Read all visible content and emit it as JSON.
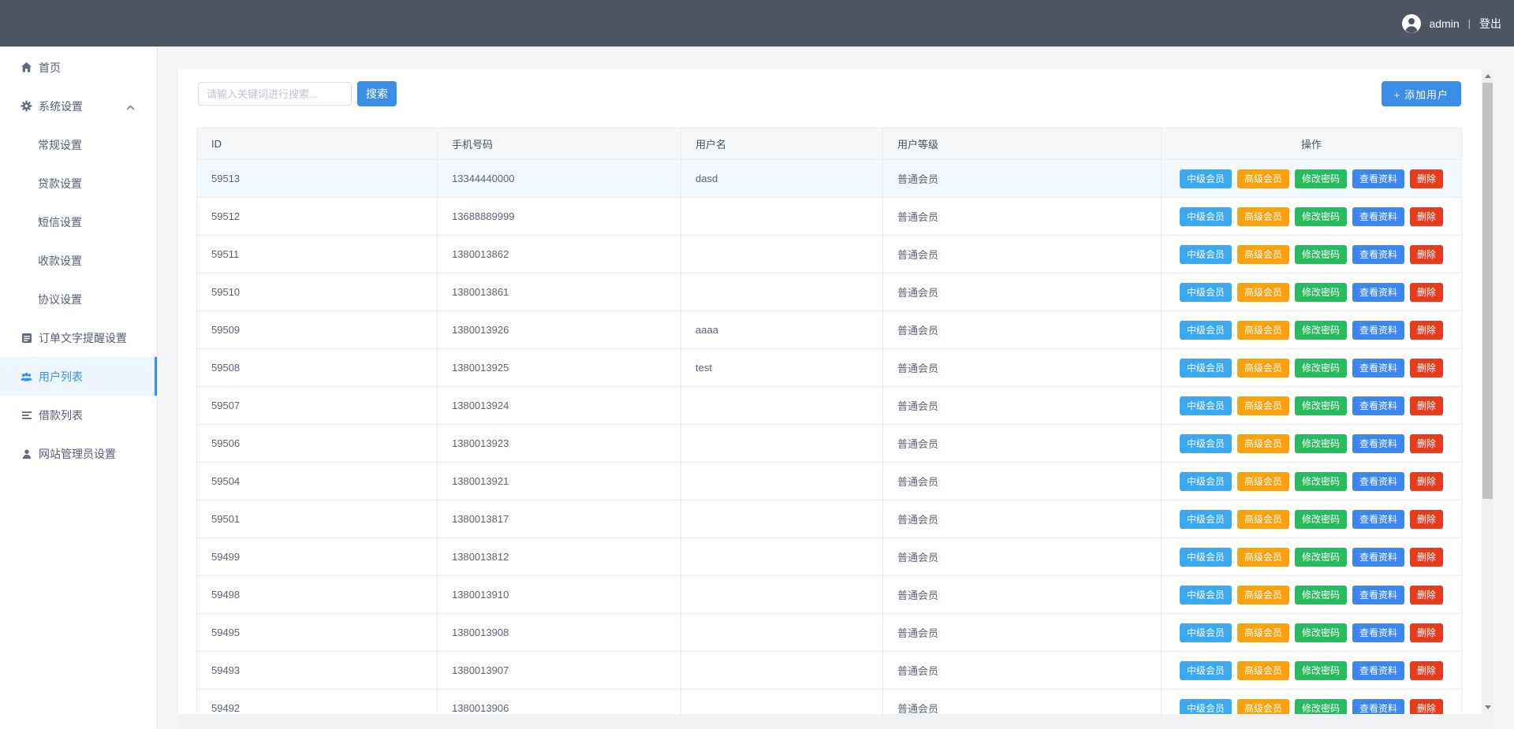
{
  "header": {
    "username": "admin",
    "separator": "|",
    "logout_label": "登出"
  },
  "sidebar": {
    "items": [
      {
        "name": "home",
        "label": "首页",
        "icon": "home-icon"
      },
      {
        "name": "system-settings",
        "label": "系统设置",
        "icon": "gear-icon",
        "chevron": "up"
      },
      {
        "name": "general-settings",
        "label": "常规设置",
        "sub": true
      },
      {
        "name": "loan-settings",
        "label": "贷款设置",
        "sub": true
      },
      {
        "name": "sms-settings",
        "label": "短信设置",
        "sub": true
      },
      {
        "name": "payment-settings",
        "label": "收款设置",
        "sub": true
      },
      {
        "name": "agreement-settings",
        "label": "协议设置",
        "sub": true
      },
      {
        "name": "order-text-reminder-settings",
        "label": "订单文字提醒设置",
        "icon": "order-icon"
      },
      {
        "name": "user-list",
        "label": "用户列表",
        "icon": "users-icon",
        "active": true
      },
      {
        "name": "borrow-list",
        "label": "借款列表",
        "icon": "list-icon"
      },
      {
        "name": "site-admin-settings",
        "label": "网站管理员设置",
        "icon": "admin-icon"
      }
    ]
  },
  "toolbar": {
    "search_placeholder": "请输入关键词进行搜索...",
    "search_button": "搜索",
    "add_user_button": "+ 添加用户"
  },
  "table": {
    "columns": [
      "ID",
      "手机号码",
      "用户名",
      "用户等级",
      "操作"
    ],
    "actions": [
      {
        "name": "mid-member",
        "label": "中级会员",
        "color": "#3aa9f0"
      },
      {
        "name": "high-member",
        "label": "高级会员",
        "color": "#f9a20c"
      },
      {
        "name": "change-password",
        "label": "修改密码",
        "color": "#27bd5e"
      },
      {
        "name": "view-profile",
        "label": "查看资料",
        "color": "#3d87ec"
      },
      {
        "name": "delete",
        "label": "删除",
        "color": "#e43c1d"
      }
    ],
    "rows": [
      {
        "id": "59513",
        "phone": "13344440000",
        "username": "dasd",
        "level": "普通会员",
        "highlighted": true
      },
      {
        "id": "59512",
        "phone": "13688889999",
        "username": "",
        "level": "普通会员"
      },
      {
        "id": "59511",
        "phone": "1380013862",
        "username": "",
        "level": "普通会员"
      },
      {
        "id": "59510",
        "phone": "1380013861",
        "username": "",
        "level": "普通会员"
      },
      {
        "id": "59509",
        "phone": "1380013926",
        "username": "aaaa",
        "level": "普通会员"
      },
      {
        "id": "59508",
        "phone": "1380013925",
        "username": "test",
        "level": "普通会员"
      },
      {
        "id": "59507",
        "phone": "1380013924",
        "username": "",
        "level": "普通会员"
      },
      {
        "id": "59506",
        "phone": "1380013923",
        "username": "",
        "level": "普通会员"
      },
      {
        "id": "59504",
        "phone": "1380013921",
        "username": "",
        "level": "普通会员"
      },
      {
        "id": "59501",
        "phone": "1380013817",
        "username": "",
        "level": "普通会员"
      },
      {
        "id": "59499",
        "phone": "1380013812",
        "username": "",
        "level": "普通会员"
      },
      {
        "id": "59498",
        "phone": "1380013910",
        "username": "",
        "level": "普通会员"
      },
      {
        "id": "59495",
        "phone": "1380013908",
        "username": "",
        "level": "普通会员"
      },
      {
        "id": "59493",
        "phone": "1380013907",
        "username": "",
        "level": "普通会员"
      },
      {
        "id": "59492",
        "phone": "1380013906",
        "username": "",
        "level": "普通会员"
      }
    ]
  },
  "colors": {
    "accent_blue": "#3a8ee6",
    "topbar_bg": "#4d5565",
    "active_item_bg": "#edf6fe",
    "table_header_bg": "#f4f6f8",
    "row_highlight_bg": "#f2f9fe"
  }
}
